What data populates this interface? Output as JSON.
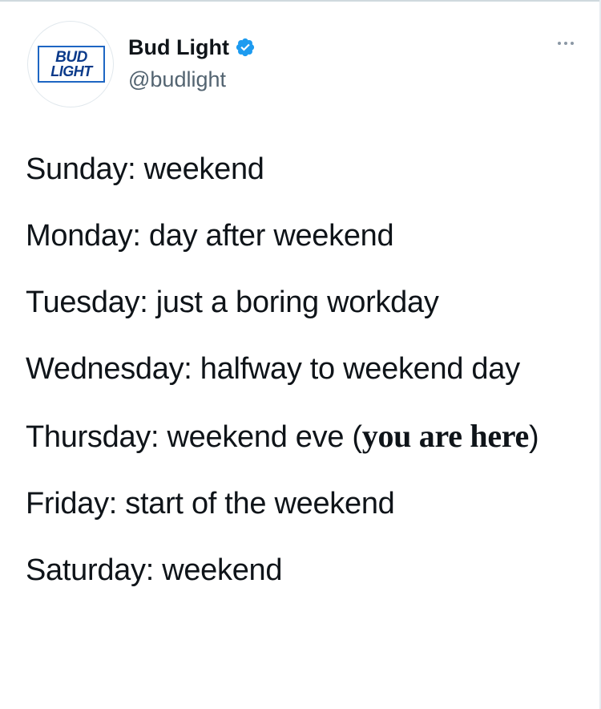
{
  "tweet": {
    "author": {
      "display_name": "Bud Light",
      "handle": "@budlight",
      "verified": true,
      "avatar_logo": {
        "line1": "BUD",
        "line2": "LIGHT"
      }
    },
    "more_icon": "more-horizontal-icon",
    "lines": [
      "Sunday: weekend",
      "Monday: day after weekend",
      "Tuesday: just a boring workday",
      "Wednesday: halfway to weekend day",
      {
        "before": "Thursday: weekend eve (",
        "bold": "you are here",
        "after": ")"
      },
      "Friday: start of the weekend",
      "Saturday: weekend"
    ]
  },
  "colors": {
    "verified_badge": "#1d9bf0",
    "handle_text": "#536471",
    "logo_blue": "#0b3a8a"
  }
}
